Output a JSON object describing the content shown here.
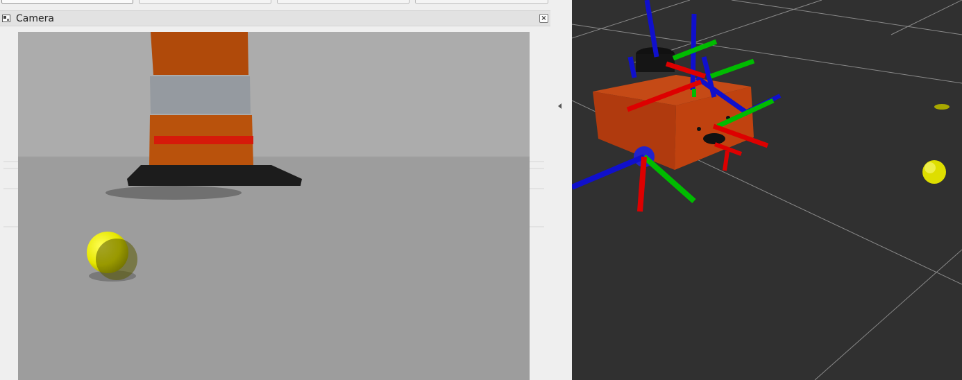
{
  "camera_panel": {
    "title": "Camera",
    "close_icon": "close-icon",
    "panel_icon": "image-view-icon"
  },
  "top_tabs": {
    "count": 4,
    "active_index": 0
  },
  "colors": {
    "panel_bg": "#efefef",
    "title_bar": "#e2e2e2",
    "view3d_bg": "#303030",
    "cone_orange": "#c24f0a",
    "cone_stripe": "#9a9ea5",
    "ball_yellow": "#e6e600",
    "robot_body": "#b53d12",
    "axis_x": "#dd0000",
    "axis_y": "#00bb00",
    "axis_z": "#1010cc"
  },
  "splitter": {
    "icon": "collapse-arrow-icon"
  }
}
